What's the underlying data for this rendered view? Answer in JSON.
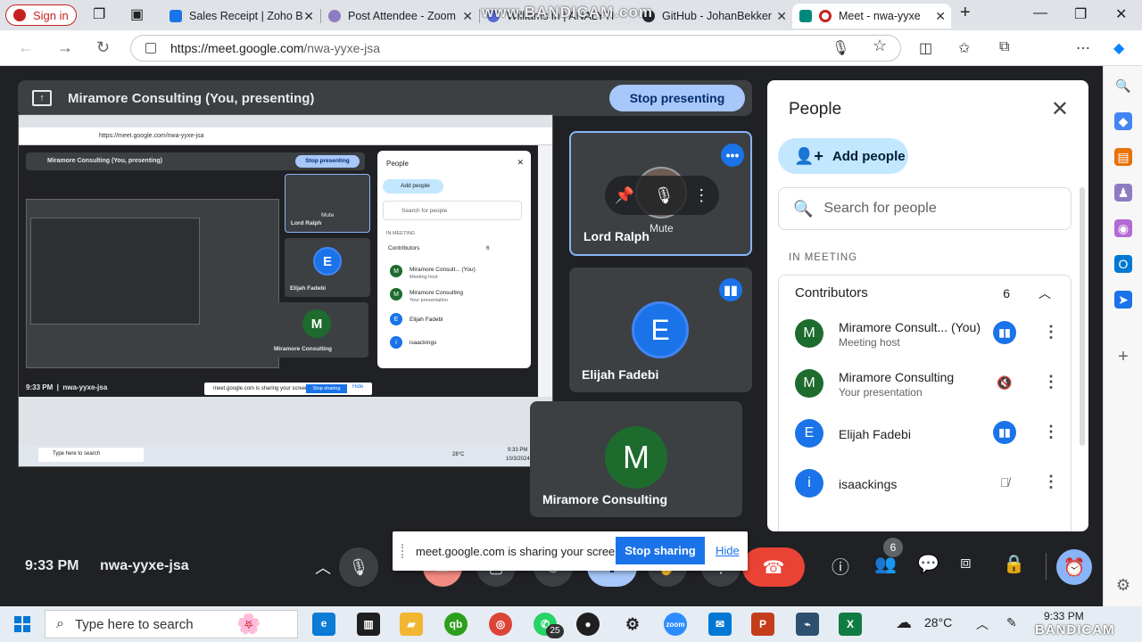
{
  "browser": {
    "signin_label": "Sign in",
    "tabs": [
      {
        "label": "Sales Receipt | Zoho B",
        "color": "#1a73e8"
      },
      {
        "label": "Post Attendee - Zoom",
        "color": "#8e7cc3"
      },
      {
        "label": "Williams in | ANALYTI",
        "color": "#5b6bd6"
      },
      {
        "label": "GitHub - JohanBekker",
        "color": "#24292f"
      },
      {
        "label": "Meet - nwa-yyxe",
        "color": "#00897b"
      }
    ],
    "url_host": "https://meet.google.com",
    "url_path": "/nwa-yyxe-jsa"
  },
  "watermark": {
    "top": "www.BANDICAM.com",
    "bottom": "BANDICAM"
  },
  "presenting": {
    "banner_title": "Miramore Consulting (You, presenting)",
    "stop_label": "Stop presenting"
  },
  "thumbnail": {
    "url": "https://meet.google.com/nwa-yyxe-jsa",
    "banner": "Miramore Consulting (You, presenting)",
    "stop": "Stop presenting",
    "tile_lord": "Lord Ralph",
    "tile_mute": "Mute",
    "tile_elijah": "Elijah Fadebi",
    "tile_miramore": "Miramore Consulting",
    "people_title": "People",
    "add_people": "Add people",
    "search": "Search for people",
    "in_meeting": "IN MEETING",
    "contributors": "Contributors",
    "count": "6",
    "rows": [
      {
        "name": "Miramore Consult...  (You)",
        "sub": "Meeting host"
      },
      {
        "name": "Miramore Consulting",
        "sub": "Your presentation"
      },
      {
        "name": "Elijah Fadebi",
        "sub": ""
      },
      {
        "name": "isaackings",
        "sub": ""
      }
    ],
    "time": "9:33 PM",
    "code": "nwa-yyxe-jsa",
    "share_text": "meet.google.com is sharing your screen.",
    "share_stop": "Stop sharing",
    "share_hide": "Hide",
    "taskbar_search": "Type here to search",
    "temp": "28°C",
    "tray_time": "9:33 PM",
    "tray_date": "10/3/2024"
  },
  "tiles": [
    {
      "name": "Lord Ralph",
      "initial": "",
      "hover_label": "Mute",
      "color": "#5f6368"
    },
    {
      "name": "Elijah Fadebi",
      "initial": "E",
      "color": "#1a73e8"
    },
    {
      "name": "Miramore Consulting",
      "initial": "M",
      "color": "#1e6b2e"
    }
  ],
  "people_panel": {
    "title": "People",
    "add_label": "Add people",
    "search_placeholder": "Search for people",
    "section": "IN MEETING",
    "group_label": "Contributors",
    "group_count": "6",
    "participants": [
      {
        "initial": "M",
        "name": "Miramore Consult...  (You)",
        "sub": "Meeting host",
        "color": "#1e6b2e",
        "mic": "speaking"
      },
      {
        "initial": "M",
        "name": "Miramore Consulting",
        "sub": "Your presentation",
        "color": "#1e6b2e",
        "mic": "muted"
      },
      {
        "initial": "E",
        "name": "Elijah Fadebi",
        "sub": "",
        "color": "#1a73e8",
        "mic": "speaking"
      },
      {
        "initial": "i",
        "name": "isaackings",
        "sub": "",
        "color": "#1a73e8",
        "mic": "muted"
      }
    ]
  },
  "bottom_bar": {
    "time": "9:33 PM",
    "meeting_code": "nwa-yyxe-jsa",
    "people_count": "6"
  },
  "share_notice": {
    "text": "meet.google.com is sharing your screen.",
    "stop_label": "Stop sharing",
    "hide_label": "Hide"
  },
  "taskbar": {
    "search_placeholder": "Type here to search",
    "whatsapp_badge": "25",
    "zoom_label": "zoom",
    "temperature": "28°C",
    "clock": "9:33 PM"
  }
}
